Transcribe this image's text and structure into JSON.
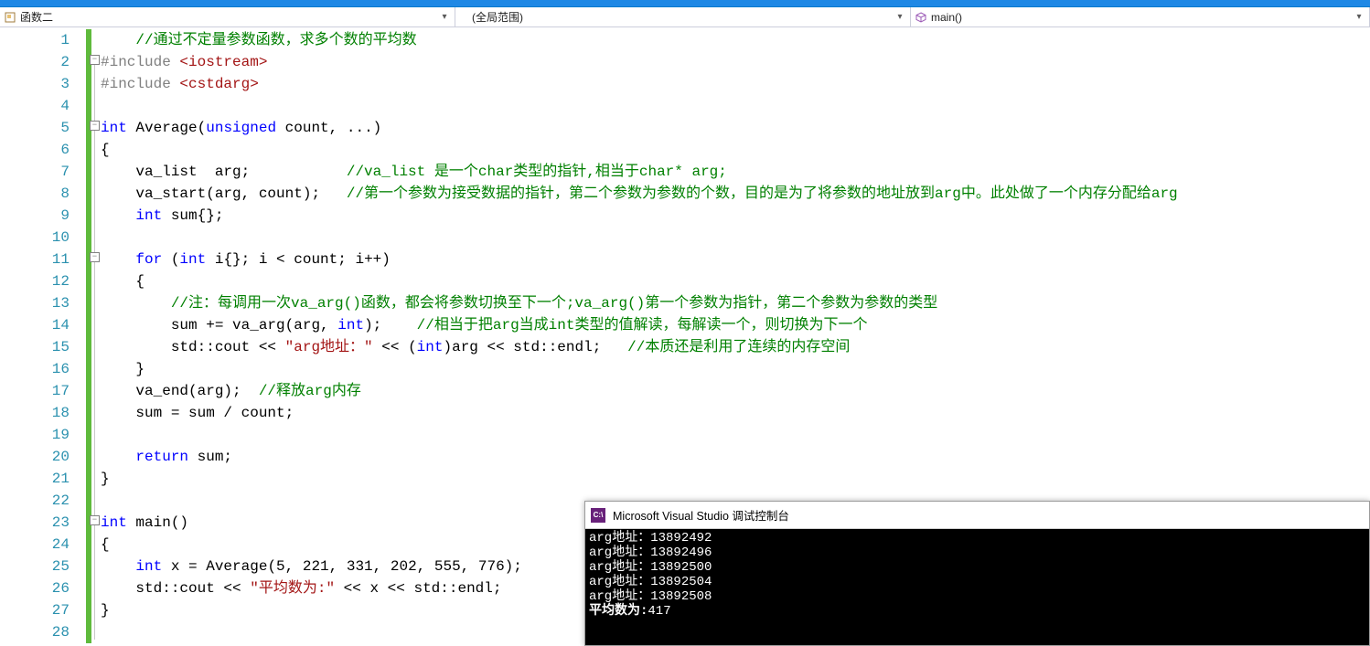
{
  "nav": {
    "project": {
      "label": "函数二",
      "icon": "class-icon"
    },
    "scope": {
      "label": "(全局范围)"
    },
    "func": {
      "label": "main()",
      "icon": "cube-icon"
    }
  },
  "gutter": {
    "start": 1,
    "end": 28
  },
  "code": {
    "l1": {
      "c1": "//通过不定量参数函数，求多个数的平均数"
    },
    "l2": {
      "d1": "#include ",
      "s1": "<iostream>"
    },
    "l3": {
      "d1": "#include ",
      "s1": "<cstdarg>"
    },
    "l4": "",
    "l5": {
      "k1": "int",
      "i1": " Average(",
      "k2": "unsigned",
      "i2": " count, ...)"
    },
    "l6": "{",
    "l7": {
      "t1": "    va_list  arg;           ",
      "c1": "//va_list 是一个char类型的指针,相当于char* arg;"
    },
    "l8": {
      "t1": "    va_start(arg, count);   ",
      "c1": "//第一个参数为接受数据的指针，第二个参数为参数的个数，目的是为了将参数的地址放到arg中。此处做了一个内存分配给arg"
    },
    "l9": {
      "k1": "int",
      "t1": "    ",
      "t2": " sum{};"
    },
    "l10": "",
    "l11": {
      "t1": "    ",
      "k1": "for",
      "t2": " (",
      "k2": "int",
      "t3": " i{}; i < count; i++)"
    },
    "l12": "    {",
    "l13": {
      "t1": "        ",
      "c1": "//注：每调用一次va_arg()函数，都会将参数切换至下一个;va_arg()第一个参数为指针，第二个参数为参数的类型"
    },
    "l14": {
      "t1": "        sum += va_arg(arg, ",
      "k1": "int",
      "t2": ");    ",
      "c1": "//相当于把arg当成int类型的值解读，每解读一个，则切换为下一个"
    },
    "l15": {
      "t1": "        std::cout << ",
      "s1": "\"arg地址：\"",
      "t2": " << (",
      "k1": "int",
      "t3": ")arg << std::endl;   ",
      "c1": "//本质还是利用了连续的内存空间"
    },
    "l16": "    }",
    "l17": {
      "t1": "    va_end(arg);  ",
      "c1": "//释放arg内存"
    },
    "l18": "    sum = sum / count;",
    "l19": "",
    "l20": {
      "t1": "    ",
      "k1": "return",
      "t2": " sum;"
    },
    "l21": "}",
    "l22": "",
    "l23": {
      "k1": "int",
      "t1": " main()"
    },
    "l24": "{",
    "l25": {
      "t1": "    ",
      "k1": "int",
      "t2": " x = Average(5, 221, 331, 202, 555, 776);"
    },
    "l26": {
      "t1": "    std::cout << ",
      "s1": "\"平均数为:\"",
      "t2": " << x << std::endl;"
    },
    "l27": "}",
    "l28": ""
  },
  "console": {
    "title": "Microsoft Visual Studio 调试控制台",
    "appicon": "C:\\",
    "lines": [
      {
        "label": "arg地址：",
        "value": "13892492"
      },
      {
        "label": "arg地址：",
        "value": "13892496"
      },
      {
        "label": "arg地址：",
        "value": "13892500"
      },
      {
        "label": "arg地址：",
        "value": "13892504"
      },
      {
        "label": "arg地址：",
        "value": "13892508"
      },
      {
        "label": "平均数为:",
        "value": "417"
      }
    ]
  }
}
